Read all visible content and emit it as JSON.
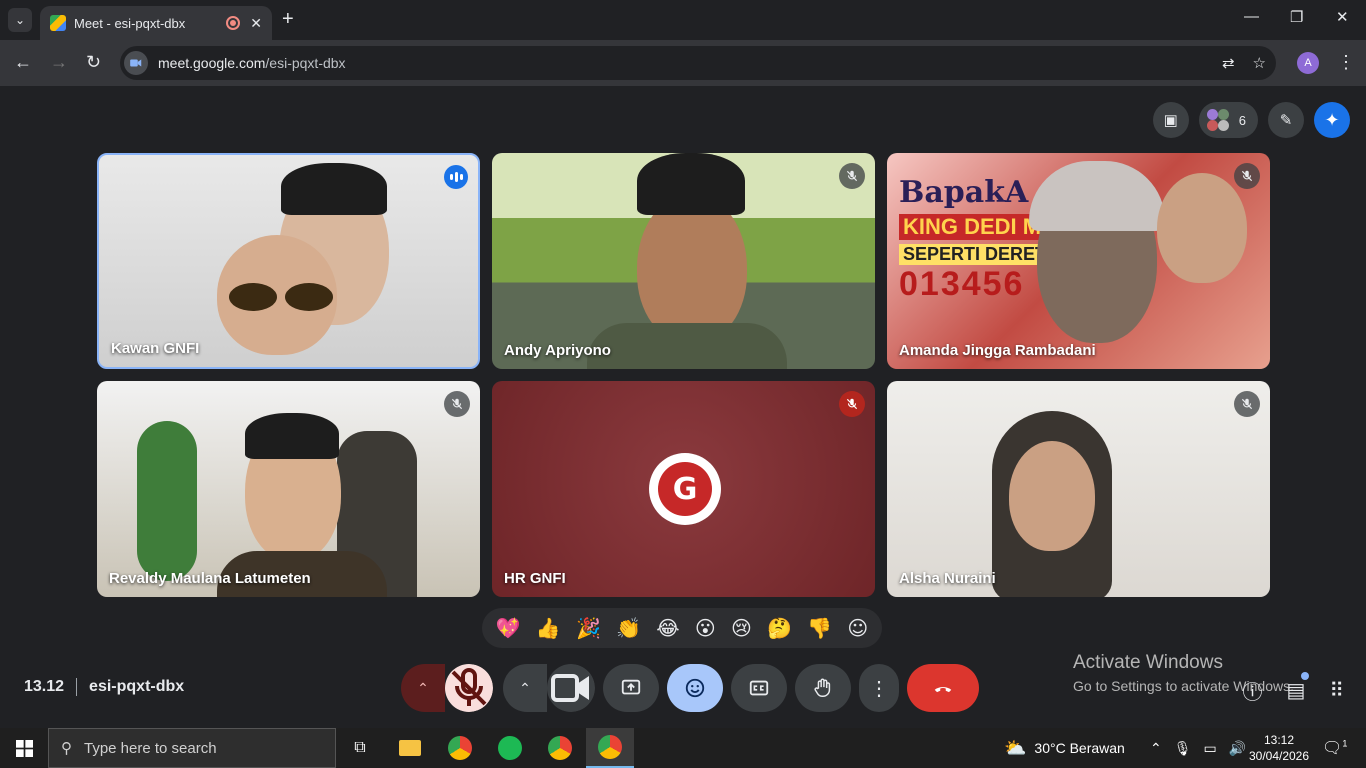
{
  "browser": {
    "tab_title": "Meet - esi-pqxt-dbx",
    "new_tab": "+",
    "url_host": "meet.google.com",
    "url_path": "/esi-pqxt-dbx",
    "profile_initial": "A"
  },
  "meet": {
    "participant_count": "6",
    "tiles": [
      {
        "name": "Kawan GNFI",
        "state": "speaking"
      },
      {
        "name": "Andy Apriyono",
        "state": "muted"
      },
      {
        "name": "Amanda Jingga Rambadani",
        "state": "muted"
      },
      {
        "name": "Revaldy Maulana Latumeten",
        "state": "muted"
      },
      {
        "name": "HR GNFI",
        "state": "muted"
      },
      {
        "name": "Alsha Nuraini",
        "state": "muted"
      }
    ],
    "tile3_banner": {
      "line1": "BapakA",
      "line2": "KING DEDI M",
      "line3": "SEPERTI DERET",
      "line4": "013456"
    },
    "reactions": [
      "💖",
      "👍",
      "🎉",
      "👏",
      "😂",
      "😮",
      "😢",
      "🤔",
      "👎"
    ],
    "meeting_time": "13.12",
    "meeting_code": "esi-pqxt-dbx"
  },
  "windows_watermark": {
    "title": "Activate Windows",
    "subtitle": "Go to Settings to activate Windows."
  },
  "taskbar": {
    "search_placeholder": "Type here to search",
    "weather": "30°C  Berawan",
    "time": "13:12",
    "date": "30/04/2026",
    "notification_count": "1"
  }
}
